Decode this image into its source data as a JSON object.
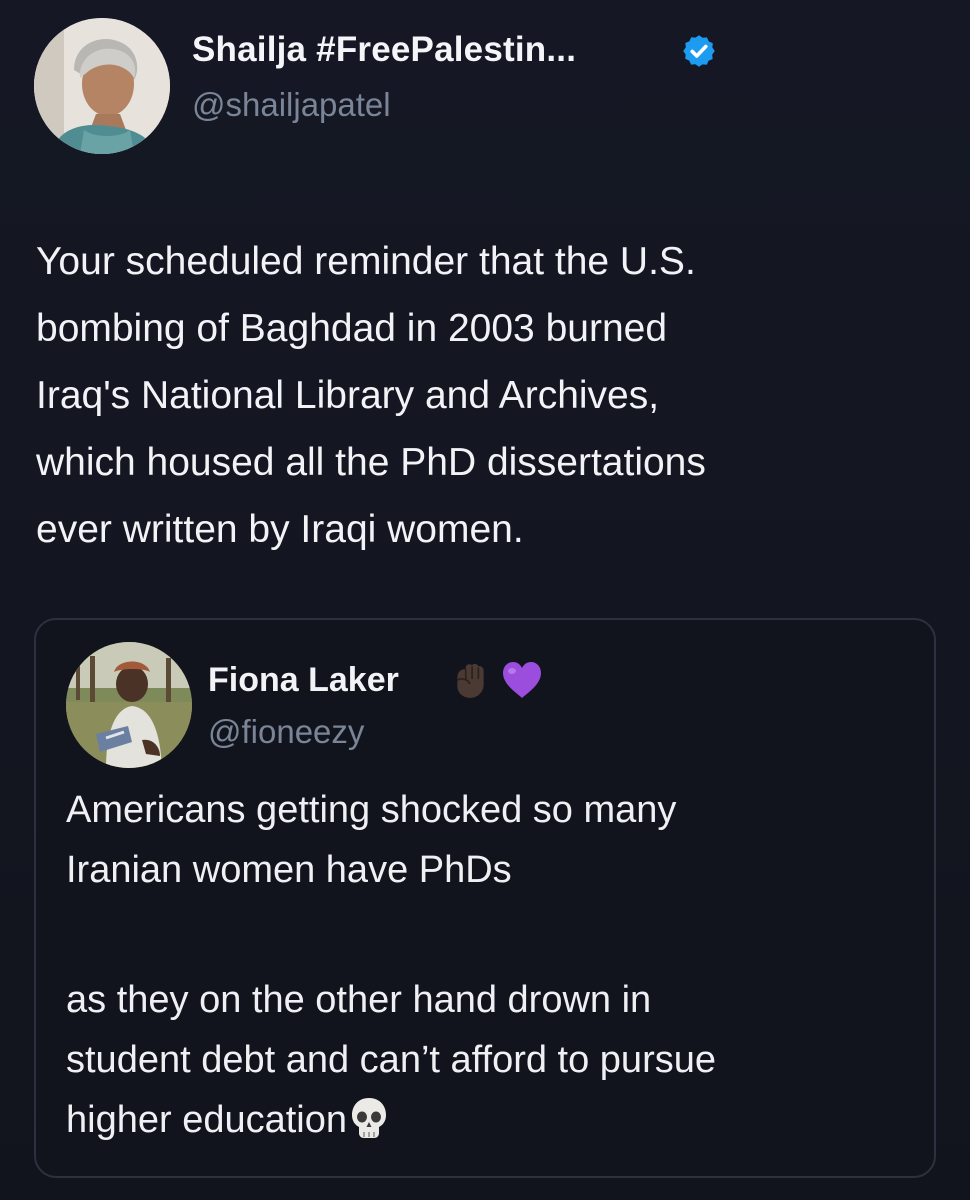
{
  "tweet": {
    "author": {
      "display_name": "Shailja #FreePalestin...",
      "handle": "@shailjapatel",
      "verified": true,
      "avatar_icon": "profile-photo"
    },
    "text_lines": [
      "Your scheduled reminder that the U.S.",
      "bombing of Baghdad in 2003 burned",
      "Iraq's National Library and Archives,",
      "which housed all the PhD dissertations",
      "ever written by Iraqi women."
    ]
  },
  "quoted_tweet": {
    "author": {
      "display_name": "Fiona Laker",
      "handle": "@fioneezy",
      "name_emojis": [
        "raised-fist-icon",
        "purple-heart-icon"
      ],
      "avatar_icon": "profile-photo"
    },
    "paragraph_1_lines": [
      "Americans getting shocked so many",
      "Iranian women have PhDs"
    ],
    "paragraph_2_lines": [
      "as they on the other hand drown in",
      "student debt and can’t afford to pursue",
      "higher education"
    ],
    "trailing_emoji": "skull-icon"
  },
  "colors": {
    "background": "#141722",
    "text": "#f2f3f6",
    "handle": "#7a8597",
    "verified_badge": "#1d9bf0",
    "quote_border": "#2c3140",
    "heart": "#9b4dde"
  }
}
